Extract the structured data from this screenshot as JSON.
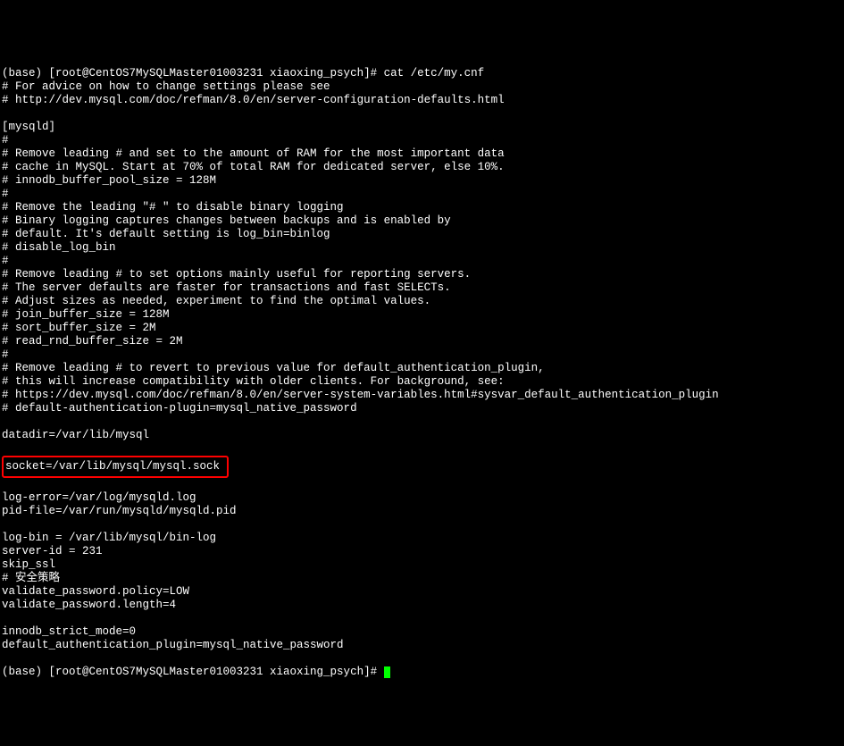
{
  "terminal": {
    "lines": [
      "(base) [root@CentOS7MySQLMaster01003231 xiaoxing_psych]# cat /etc/my.cnf",
      "# For advice on how to change settings please see",
      "# http://dev.mysql.com/doc/refman/8.0/en/server-configuration-defaults.html",
      "",
      "[mysqld]",
      "#",
      "# Remove leading # and set to the amount of RAM for the most important data",
      "# cache in MySQL. Start at 70% of total RAM for dedicated server, else 10%.",
      "# innodb_buffer_pool_size = 128M",
      "#",
      "# Remove the leading \"# \" to disable binary logging",
      "# Binary logging captures changes between backups and is enabled by",
      "# default. It's default setting is log_bin=binlog",
      "# disable_log_bin",
      "#",
      "# Remove leading # to set options mainly useful for reporting servers.",
      "# The server defaults are faster for transactions and fast SELECTs.",
      "# Adjust sizes as needed, experiment to find the optimal values.",
      "# join_buffer_size = 128M",
      "# sort_buffer_size = 2M",
      "# read_rnd_buffer_size = 2M",
      "#",
      "# Remove leading # to revert to previous value for default_authentication_plugin,",
      "# this will increase compatibility with older clients. For background, see:",
      "# https://dev.mysql.com/doc/refman/8.0/en/server-system-variables.html#sysvar_default_authentication_plugin",
      "# default-authentication-plugin=mysql_native_password",
      "",
      "datadir=/var/lib/mysql"
    ],
    "highlighted_line": "socket=/var/lib/mysql/mysql.sock",
    "lines_after": [
      "",
      "log-error=/var/log/mysqld.log",
      "pid-file=/var/run/mysqld/mysqld.pid",
      "",
      "log-bin = /var/lib/mysql/bin-log",
      "server-id = 231",
      "skip_ssl",
      "# 安全策略",
      "validate_password.policy=LOW",
      "validate_password.length=4",
      "",
      "innodb_strict_mode=0",
      "default_authentication_plugin=mysql_native_password"
    ],
    "prompt_last": "(base) [root@CentOS7MySQLMaster01003231 xiaoxing_psych]# "
  }
}
